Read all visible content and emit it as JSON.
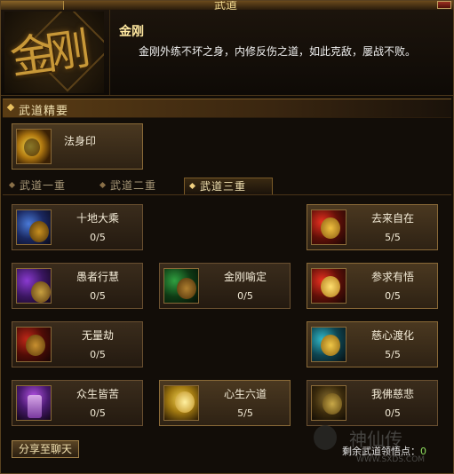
{
  "window": {
    "title": "武道"
  },
  "header": {
    "emblem_text": "金刚",
    "skill_name": "金刚",
    "skill_desc": "金刚外练不坏之身，内修反伤之道，如此克敌，屡战不败。"
  },
  "essence": {
    "section_label": "武道精要",
    "card": {
      "name": "法身印",
      "icon": "golden-seal-icon"
    }
  },
  "tabs": [
    {
      "label": "武道一重",
      "active": false
    },
    {
      "label": "武道二重",
      "active": false
    },
    {
      "label": "武道三重",
      "active": true
    }
  ],
  "skills": [
    {
      "name": "十地大乘",
      "level": "0/5",
      "icon": "blue-orb-icon"
    },
    {
      "name": "去来自在",
      "level": "5/5",
      "icon": "red-gold-icon"
    },
    {
      "name": "愚者行慧",
      "level": "0/5",
      "icon": "purple-spin-icon"
    },
    {
      "name": "金刚喻定",
      "level": "0/5",
      "icon": "green-claw-icon"
    },
    {
      "name": "参求有悟",
      "level": "0/5",
      "icon": "red-gold-icon"
    },
    {
      "name": "无量劫",
      "level": "0/5",
      "icon": "red-gold-icon"
    },
    {
      "name": "慈心渡化",
      "level": "5/5",
      "icon": "teal-gold-icon"
    },
    {
      "name": "众生皆苦",
      "level": "0/5",
      "icon": "purple-pillar-icon"
    },
    {
      "name": "心生六道",
      "level": "5/5",
      "icon": "gold-sand-icon"
    },
    {
      "name": "我佛慈悲",
      "level": "0/5",
      "icon": "gold-sand-icon"
    }
  ],
  "footer": {
    "share_label": "分享至聊天",
    "points_label": "剩余武道领悟点：",
    "points_value": "0",
    "watermark": "神仙传",
    "watermark_url": "WWW.SXDS.COM"
  },
  "colors": {
    "frame": "#120d08",
    "border_gold": "#6a5030",
    "text_gold": "#ffe8a0",
    "points_green": "#90e060"
  }
}
